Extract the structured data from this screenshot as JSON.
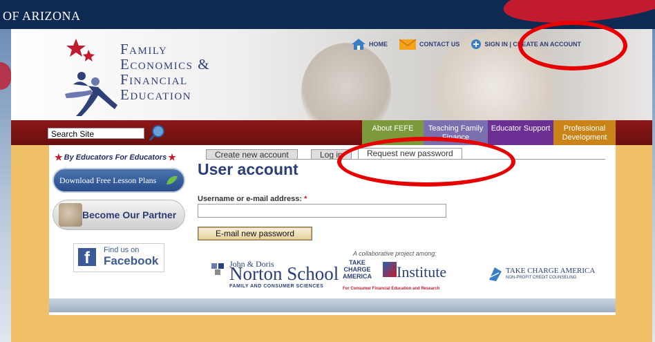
{
  "banner": {
    "university_text": "OF ARIZONA"
  },
  "logo": {
    "lines": [
      "Family",
      "Economics &",
      "Financial",
      "Education"
    ]
  },
  "top_nav": {
    "home": "HOME",
    "contact": "CONTACT US",
    "signin": "SIGN IN | CREATE AN ACCOUNT"
  },
  "navbar": {
    "search_value": "Search Site",
    "tabs": [
      "About FEFE",
      "Teaching Family Finance",
      "Educator Support",
      "Professional Development"
    ]
  },
  "sidebar": {
    "tagline": "By Educators For Educators",
    "lesson_button": "Download Free Lesson Plans",
    "partner_button": "Become Our Partner",
    "facebook_line1": "Find us on",
    "facebook_line2": "Facebook"
  },
  "main": {
    "tabs": [
      "Create new account",
      "Log in",
      "Request new password"
    ],
    "title": "User account",
    "field_label": "Username or e-mail address:",
    "required_mark": "*",
    "submit_label": "E-mail new password"
  },
  "partners": {
    "collab_text": "A collaborative project among:",
    "norton_line1": "John & Doris",
    "norton_line2": "Norton School",
    "norton_line3": "FAMILY AND CONSUMER SCIENCES",
    "tca_stack": [
      "TAKE",
      "CHARGE",
      "AMERICA"
    ],
    "tca_institute": "Institute",
    "tca_sub": "For Consumer Financial Education and Research",
    "tcam_title": "TAKE CHARGE AMERICA",
    "tcam_sub": "NON-PROFIT CREDIT COUNSELING"
  },
  "colors": {
    "nav_red": "#8c1717",
    "brand_navy": "#2a3f7a",
    "highlight_ring": "#e60000",
    "page_gold": "#f0c068"
  }
}
